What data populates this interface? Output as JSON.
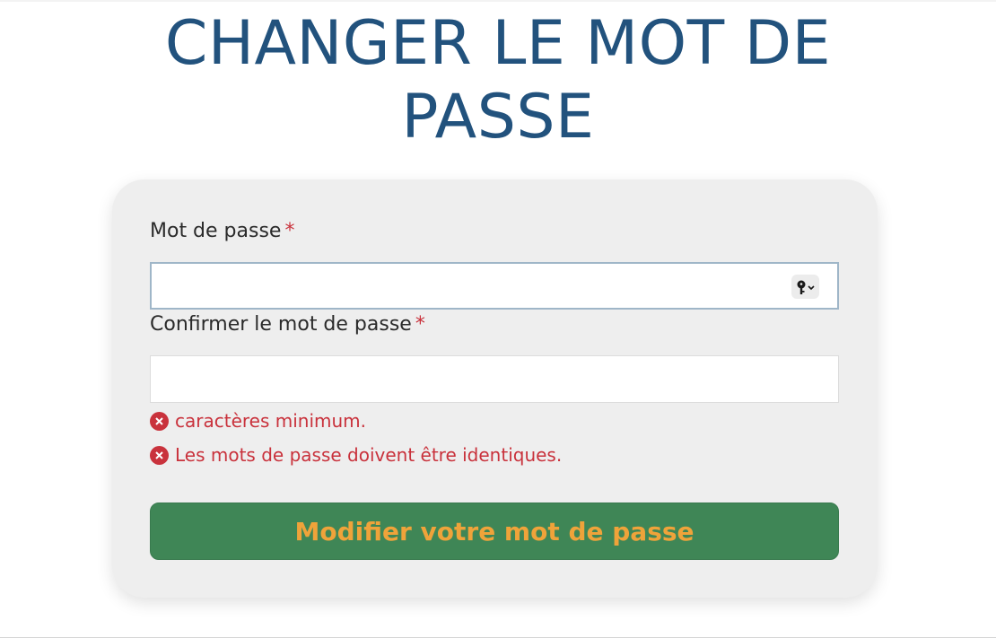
{
  "page": {
    "title_line1": "CHANGER LE MOT DE",
    "title_line2": "PASSE"
  },
  "form": {
    "password": {
      "label": "Mot de passe",
      "required_mark": "*",
      "value": "",
      "placeholder": "",
      "key_icon": "key-icon"
    },
    "confirm": {
      "label": "Confirmer le mot de passe",
      "required_mark": "*",
      "value": "",
      "placeholder": ""
    },
    "errors": [
      {
        "text": "caractères minimum.",
        "icon": "error-circle-icon"
      },
      {
        "text": "Les mots de passe doivent être identiques.",
        "icon": "error-circle-icon"
      }
    ],
    "submit_label": "Modifier votre mot de passe"
  },
  "colors": {
    "title": "#22527d",
    "error": "#c9323c",
    "button_bg": "#3f8656",
    "button_text": "#efa33a",
    "card_bg": "#eeeeee"
  }
}
